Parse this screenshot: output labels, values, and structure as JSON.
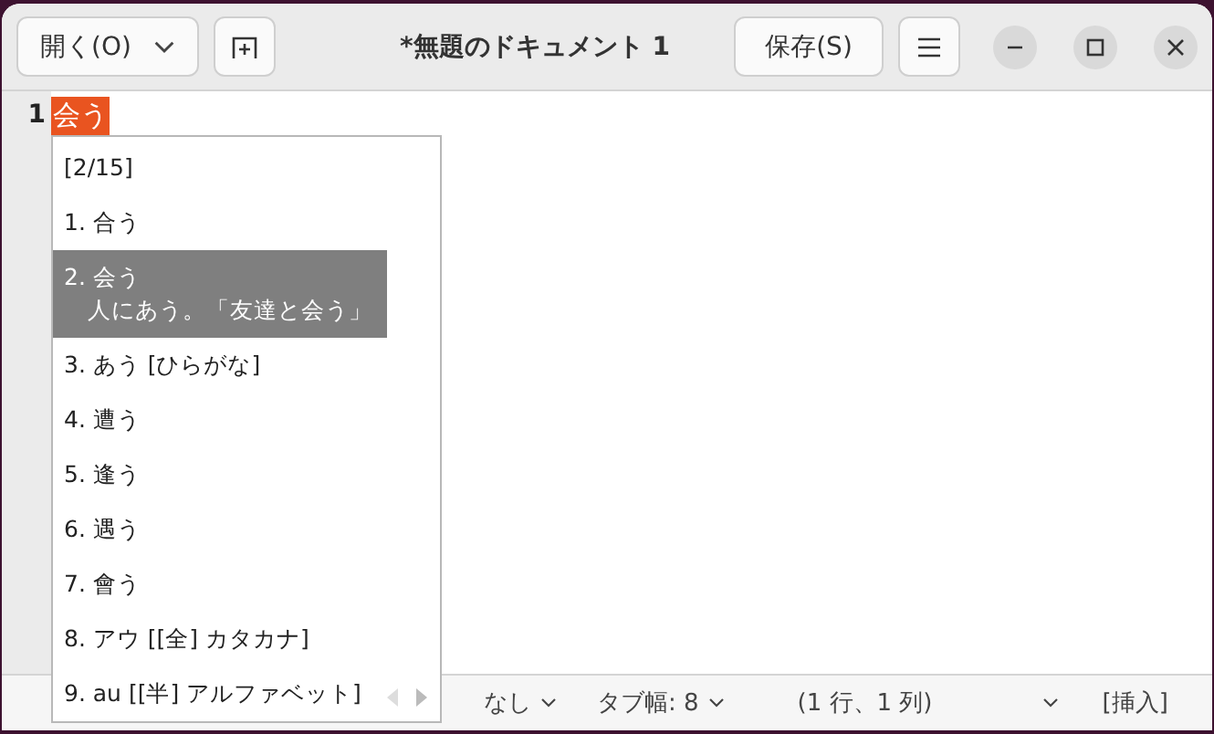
{
  "window": {
    "title": "*無題のドキュメント 1"
  },
  "header": {
    "open_button": "開く(O)",
    "save_button": "保存(S)"
  },
  "editor": {
    "lines": [
      {
        "number": "1",
        "text": "会う",
        "preedit": true
      }
    ]
  },
  "candidates": {
    "counter": "[2/15]",
    "items": [
      {
        "label": "1. 合う",
        "selected": false
      },
      {
        "label": "2. 会う",
        "note": "人にあう。「友達と会う」",
        "selected": true
      },
      {
        "label": "3. あう [ひらがな]",
        "selected": false
      },
      {
        "label": "4. 遭う",
        "selected": false
      },
      {
        "label": "5. 逢う",
        "selected": false
      },
      {
        "label": "6. 遇う",
        "selected": false
      },
      {
        "label": "7. 會う",
        "selected": false
      },
      {
        "label": "8. アウ [[全] カタカナ]",
        "selected": false
      },
      {
        "label": "9. au [[半] アルファベット]",
        "selected": false
      }
    ]
  },
  "status_bar": {
    "dropdowns": [
      "なし",
      "タブ幅: 8"
    ],
    "position": "(1 行、1 列)",
    "mode": "[挿入]"
  }
}
